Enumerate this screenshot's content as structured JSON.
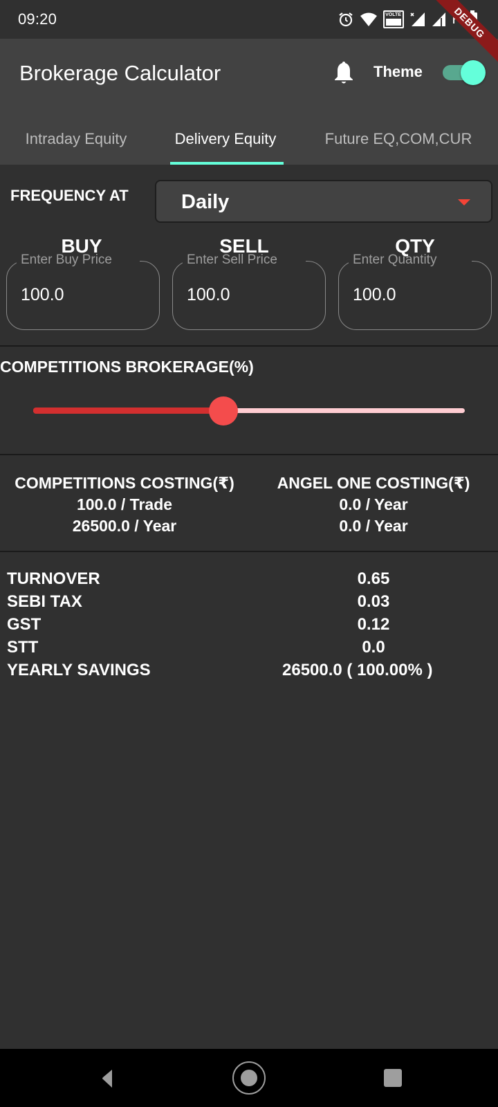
{
  "status_bar": {
    "time": "09:20",
    "icons": [
      "alarm-icon",
      "wifi-icon",
      "volte-icon",
      "signal-icon",
      "signal-icon",
      "battery-icon"
    ],
    "volte_label": "VOLTE",
    "roaming_label": "R"
  },
  "debug_banner": "DEBUG",
  "app_bar": {
    "title": "Brokerage Calculator",
    "notification_icon": "bell-icon",
    "theme_label": "Theme",
    "theme_toggle_on": true,
    "accent_color": "#64ffda"
  },
  "tabs": [
    {
      "label": "Intraday Equity",
      "active": false
    },
    {
      "label": "Delivery Equity",
      "active": true
    },
    {
      "label": "Future EQ,COM,CUR",
      "active": false
    }
  ],
  "frequency": {
    "label": "FREQUENCY AT",
    "selected": "Daily"
  },
  "inputs": [
    {
      "title": "BUY",
      "label": "Enter Buy Price",
      "value": "100.0"
    },
    {
      "title": "SELL",
      "label": "Enter Sell Price",
      "value": "100.0"
    },
    {
      "title": "QTY",
      "label": "Enter Quantity",
      "value": "100.0"
    }
  ],
  "brokerage": {
    "label": "COMPETITIONS BROKERAGE(%)",
    "slider_fraction": 0.44,
    "active_color": "#d32f2f",
    "inactive_color": "#ffcdd2"
  },
  "costing": {
    "competitions": {
      "header": "COMPETITIONS COSTING(₹)",
      "per_trade": "100.0 / Trade",
      "per_year": "26500.0 / Year"
    },
    "angel_one": {
      "header": "ANGEL ONE COSTING(₹)",
      "line1": "0.0 / Year",
      "line2": "0.0 / Year"
    }
  },
  "breakdown": [
    {
      "label": "TURNOVER",
      "value": "0.65"
    },
    {
      "label": "SEBI TAX",
      "value": "0.03"
    },
    {
      "label": "GST",
      "value": "0.12"
    },
    {
      "label": "STT",
      "value": "0.0"
    },
    {
      "label": "YEARLY SAVINGS",
      "value": "26500.0  ( 100.00% )"
    }
  ],
  "nav_bar": {
    "buttons": [
      "back-icon",
      "home-icon",
      "recents-icon"
    ]
  }
}
